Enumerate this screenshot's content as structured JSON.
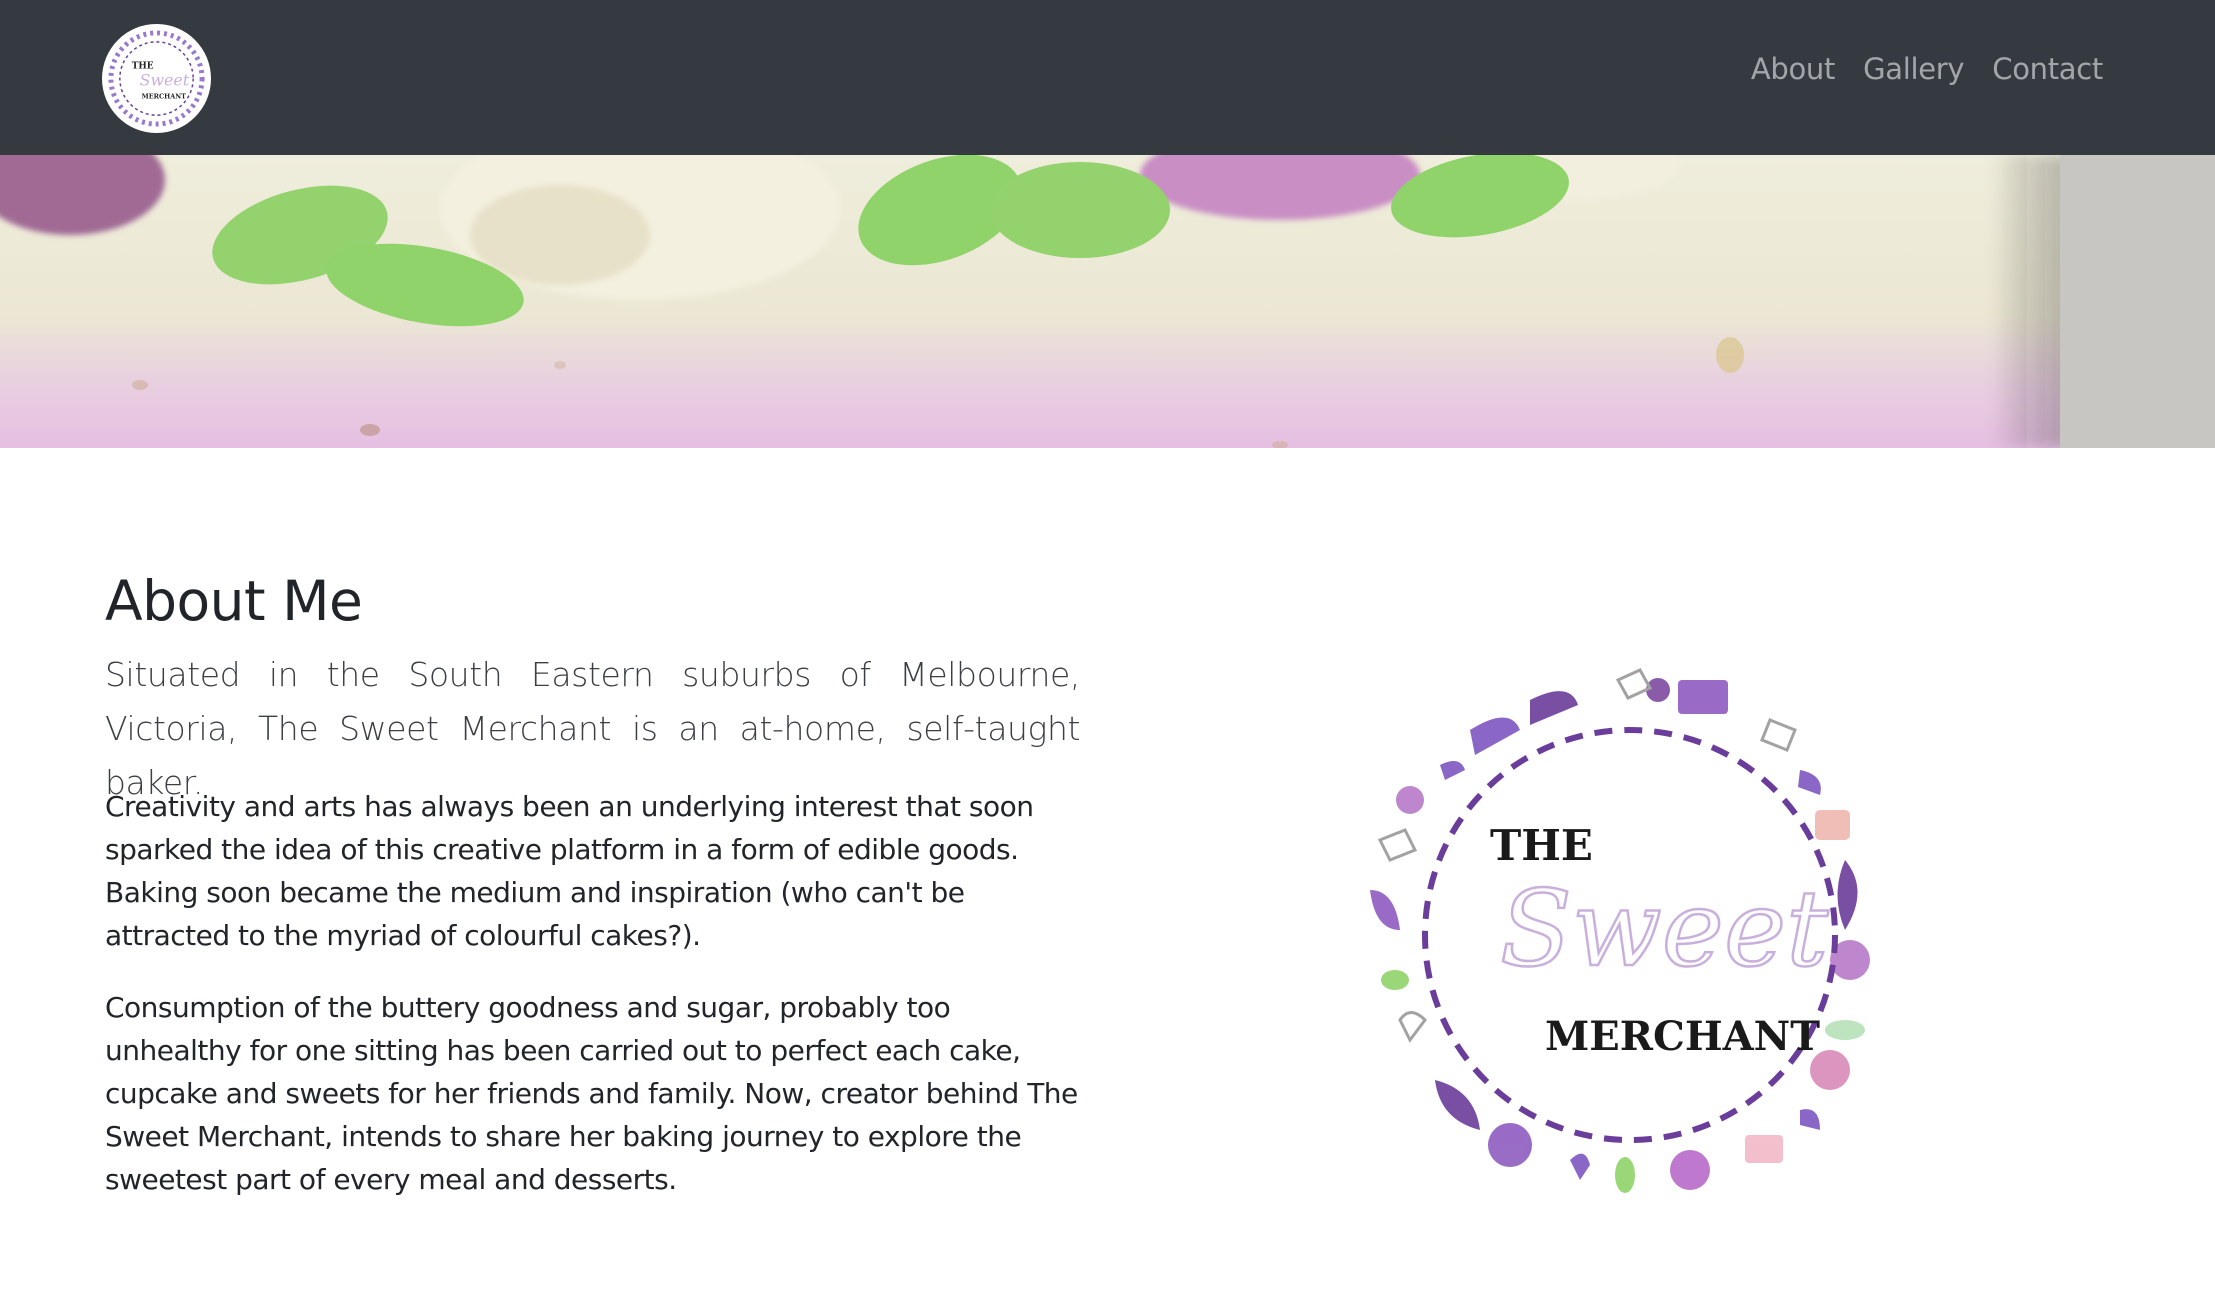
{
  "navbar": {
    "brand_logo": {
      "line1": "THE",
      "line2": "Sweet",
      "line3": "MERCHANT"
    },
    "links": [
      {
        "label": "About"
      },
      {
        "label": "Gallery"
      },
      {
        "label": "Contact"
      }
    ],
    "background_color": "#343a40"
  },
  "about": {
    "title": "About Me",
    "lead": "Situated in the South Eastern suburbs of Melbourne, Victoria, The Sweet Merchant is an at-home, self-taught baker.",
    "paragraphs": [
      "Creativity and arts has always been an underlying interest that soon sparked the idea of this creative platform in a form of edible goods. Baking soon became the medium and inspiration (who can't be attracted to the myriad of colourful cakes?).",
      "Consumption of the buttery goodness and sugar, probably too unhealthy for one sitting has been carried out to perfect each cake, cupcake and sweets for her friends and family. Now, creator behind The Sweet Merchant, intends to share her baking journey to explore the sweetest part of every meal and desserts."
    ],
    "logo": {
      "line1": "THE",
      "line2": "Sweet",
      "line3": "MERCHANT"
    }
  },
  "colors": {
    "accent_purple": "#6a3d9a",
    "light_purple": "#c9b0dc",
    "icing_green": "#8fd36a"
  }
}
